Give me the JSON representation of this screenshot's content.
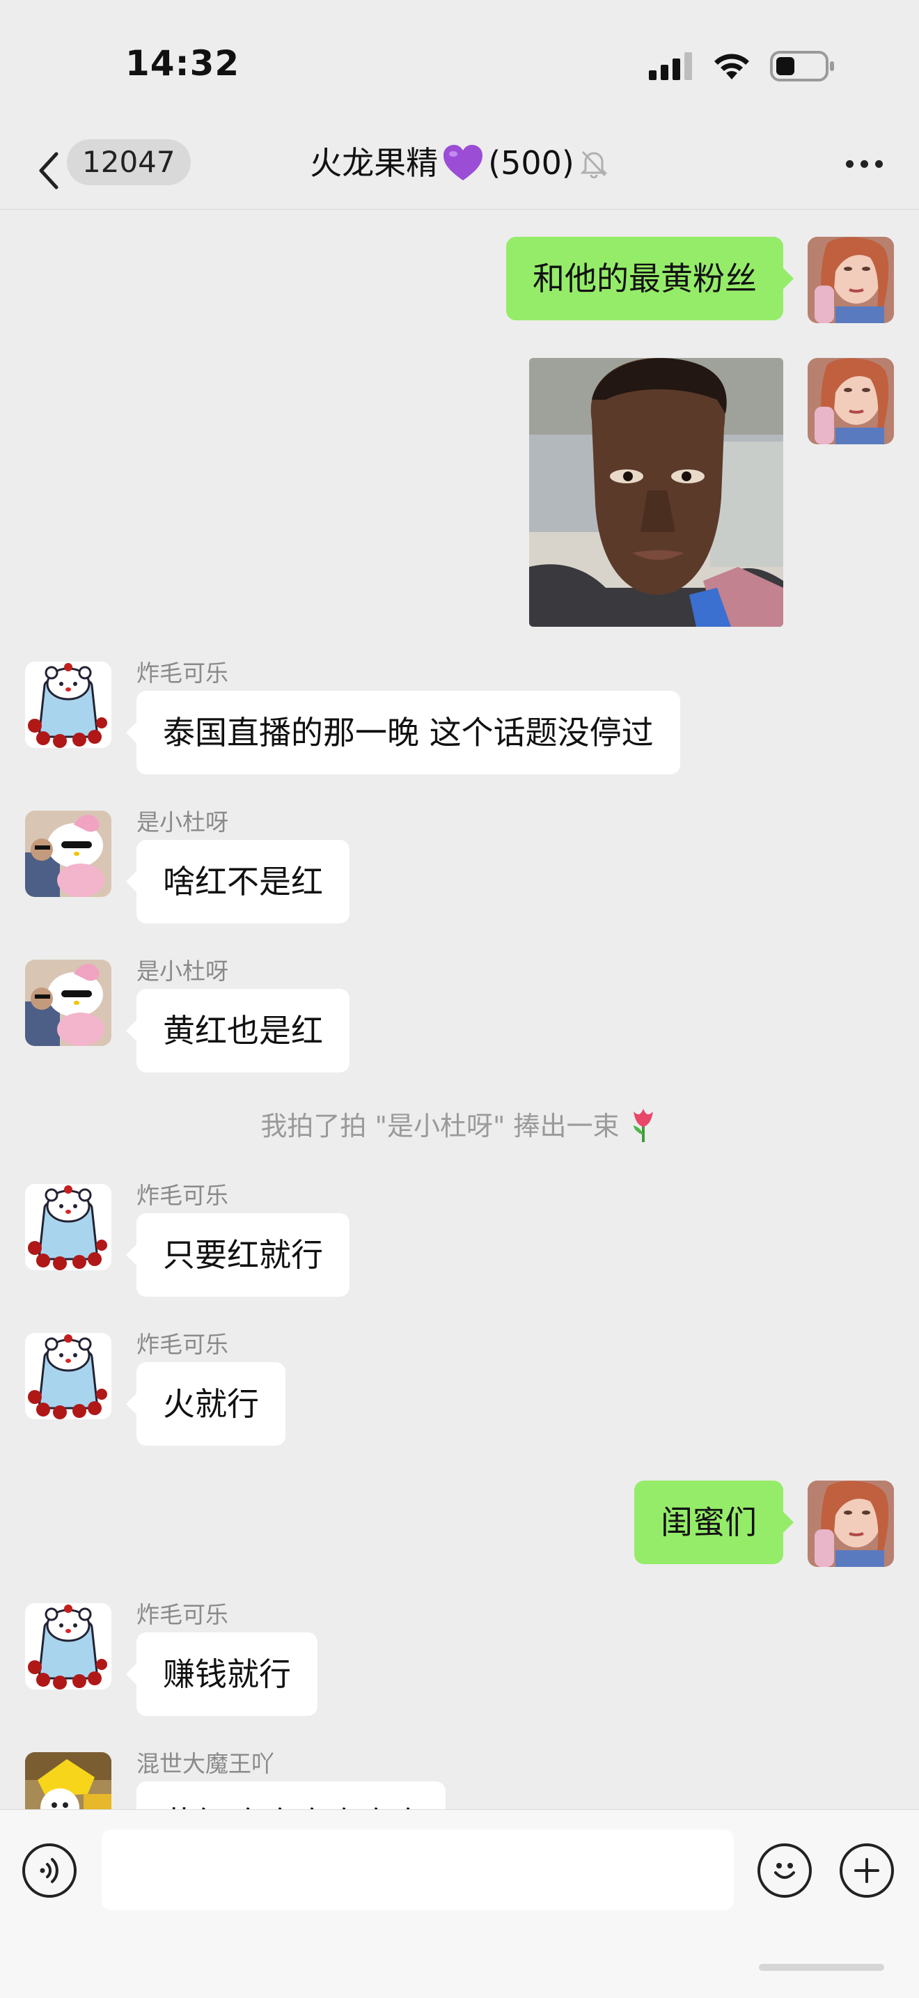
{
  "status_bar": {
    "time": "14:32"
  },
  "header": {
    "unread_count": "12047",
    "title": "火龙果精",
    "member_count": "(500)"
  },
  "messages": [
    {
      "side": "right",
      "text": "和他的最黄粉丝"
    },
    {
      "side": "right",
      "type": "image"
    },
    {
      "side": "left",
      "sender": "炸毛可乐",
      "text": "泰国直播的那一晚 这个话题没停过"
    },
    {
      "side": "left",
      "sender": "是小杜呀",
      "text": "啥红不是红"
    },
    {
      "side": "left",
      "sender": "是小杜呀",
      "text": "黄红也是红"
    },
    {
      "side": "system",
      "text": "我拍了拍 \"是小杜呀\" 捧出一束"
    },
    {
      "side": "left",
      "sender": "炸毛可乐",
      "text": "只要红就行"
    },
    {
      "side": "left",
      "sender": "炸毛可乐",
      "text": "火就行"
    },
    {
      "side": "right",
      "text": "闺蜜们"
    },
    {
      "side": "left",
      "sender": "炸毛可乐",
      "text": "赚钱就行"
    },
    {
      "side": "left",
      "sender": "混世大魔王吖",
      "text": "黄红哈哈哈哈哈哈"
    }
  ],
  "icons": {
    "back": "chevron-left-icon",
    "mute": "bell-slash-icon",
    "more": "more-dots-icon",
    "voice": "voice-icon",
    "emoji": "emoji-icon",
    "plus": "plus-icon",
    "title_emoji": "purple-heart-icon",
    "sys_emoji": "tulip-icon"
  },
  "colors": {
    "background": "#ededed",
    "my_bubble": "#95ec69",
    "other_bubble": "#ffffff",
    "heart": "#9b4dd6"
  }
}
